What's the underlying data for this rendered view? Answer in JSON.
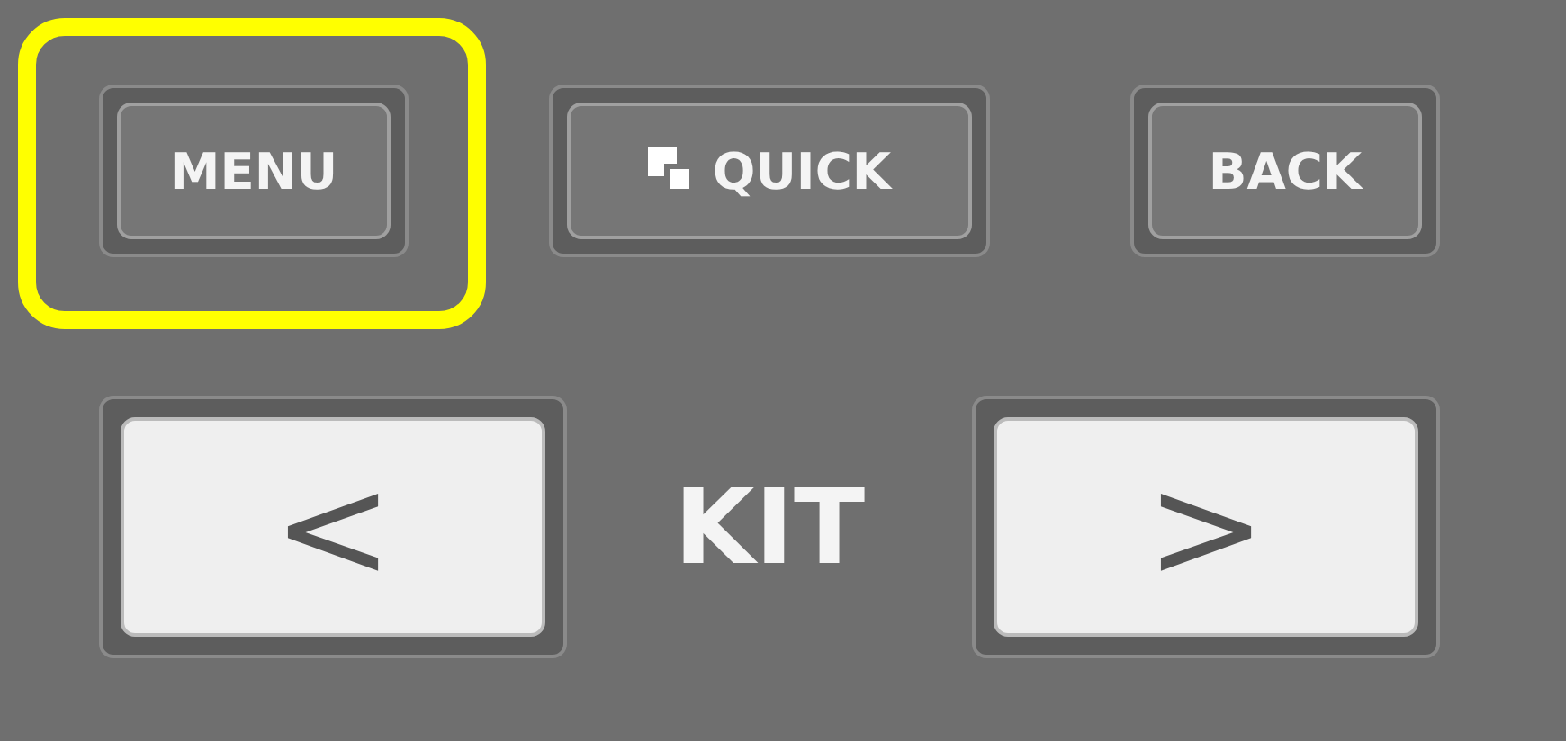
{
  "top_buttons": [
    {
      "kind": "text",
      "label": "MENU",
      "highlighted": true
    },
    {
      "kind": "icon",
      "label": "QUICK",
      "highlighted": false
    },
    {
      "kind": "text",
      "label": "BACK",
      "highlighted": false
    }
  ],
  "kit": {
    "prev": "<",
    "label": "KIT",
    "next": ">"
  }
}
